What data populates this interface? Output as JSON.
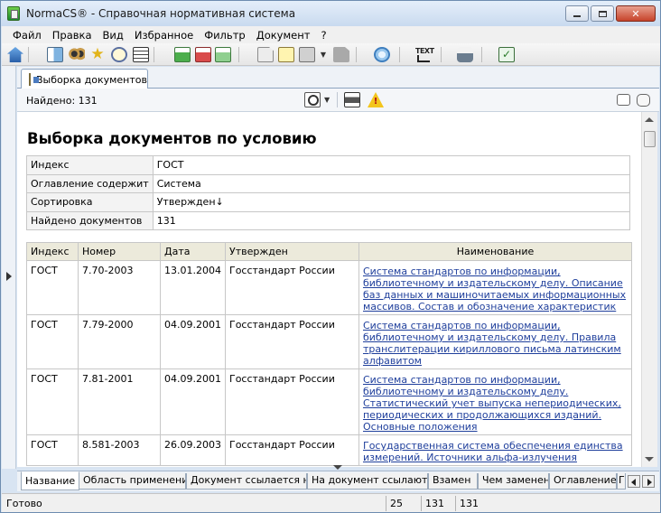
{
  "window": {
    "title": "NormaCS® - Справочная нормативная система"
  },
  "menu": [
    "Файл",
    "Правка",
    "Вид",
    "Избранное",
    "Фильтр",
    "Документ",
    "?"
  ],
  "toolbar": {
    "icons": [
      "home-icon",
      "tree-icon",
      "binoculars-icon",
      "star-icon",
      "clock-icon",
      "doc-list-icon",
      "green-doc-icon",
      "red-doc-icon",
      "green-red-doc-icon",
      "page-icon",
      "yellow-page-icon",
      "gray-page-icon",
      "dropdown-arrow-icon",
      "gray-doc-icon",
      "link-icon",
      "text-icon",
      "cars-icon",
      "check-icon"
    ]
  },
  "doc_tab": {
    "label": "Выборка документов"
  },
  "found": {
    "text": "Найдено: 131"
  },
  "page": {
    "title": "Выборка документов по условию"
  },
  "query": [
    {
      "key": "Индекс",
      "value": "ГОСТ"
    },
    {
      "key": "Оглавление содержит",
      "value": "Система"
    },
    {
      "key": "Сортировка",
      "value": "Утвержден↓"
    },
    {
      "key": "Найдено документов",
      "value": "131"
    }
  ],
  "results": {
    "headers": [
      "Индекс",
      "Номер",
      "Дата",
      "Утвержден",
      "Наименование"
    ],
    "rows": [
      {
        "index": "ГОСТ",
        "number": "7.70-2003",
        "date": "13.01.2004",
        "approved": "Госстандарт России",
        "name": "Система стандартов по информации, библиотечному и издательскому делу. Описание баз данных и машиночитаемых информационных массивов. Состав и обозначение характеристик"
      },
      {
        "index": "ГОСТ",
        "number": "7.79-2000",
        "date": "04.09.2001",
        "approved": "Госстандарт России",
        "name": "Система стандартов по информации, библиотечному и издательскому делу. Правила транслитерации кириллового письма латинским алфавитом"
      },
      {
        "index": "ГОСТ",
        "number": "7.81-2001",
        "date": "04.09.2001",
        "approved": "Госстандарт России",
        "name": "Система стандартов по информации, библиотечному и издательскому делу. Статистический учет выпуска непериодических, периодических и продолжающихся изданий. Основные положения"
      },
      {
        "index": "ГОСТ",
        "number": "8.581-2003",
        "date": "26.09.2003",
        "approved": "Госстандарт России",
        "name": "Государственная система обеспечения единства измерений. Источники альфа-излучения"
      }
    ]
  },
  "bottom_tabs": [
    "Название",
    "Область применения",
    "Документ ссылается на",
    "На документ ссылаются",
    "Взамен",
    "Чем заменен",
    "Оглавление",
    "Г"
  ],
  "status": {
    "text": "Готово",
    "cells": [
      "25",
      "131",
      "131"
    ]
  }
}
